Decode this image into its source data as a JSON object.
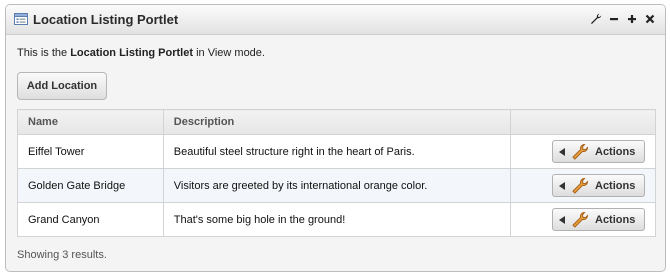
{
  "portlet": {
    "title": "Location Listing Portlet",
    "controls": {
      "config_icon": "wrench-icon",
      "minimize_icon": "minus-icon",
      "maximize_icon": "plus-icon",
      "close_icon": "close-icon"
    }
  },
  "intro": {
    "prefix": "This is the ",
    "name": "Location Listing Portlet",
    "suffix": " in View mode."
  },
  "add_button_label": "Add Location",
  "table": {
    "headers": {
      "name": "Name",
      "description": "Description",
      "actions": ""
    },
    "rows": [
      {
        "name": "Eiffel Tower",
        "description": "Beautiful steel structure right in the heart of Paris.",
        "action_label": "Actions"
      },
      {
        "name": "Golden Gate Bridge",
        "description": "Visitors are greeted by its international orange color.",
        "action_label": "Actions"
      },
      {
        "name": "Grand Canyon",
        "description": "That's some big hole in the ground!",
        "action_label": "Actions"
      }
    ]
  },
  "results_text": "Showing 3 results.",
  "colors": {
    "title_bar_top": "#fbfbfb",
    "title_bar_bottom": "#e2e2e2",
    "wrench_accent": "#d8892c",
    "row_alt": "#f3f6fa"
  }
}
